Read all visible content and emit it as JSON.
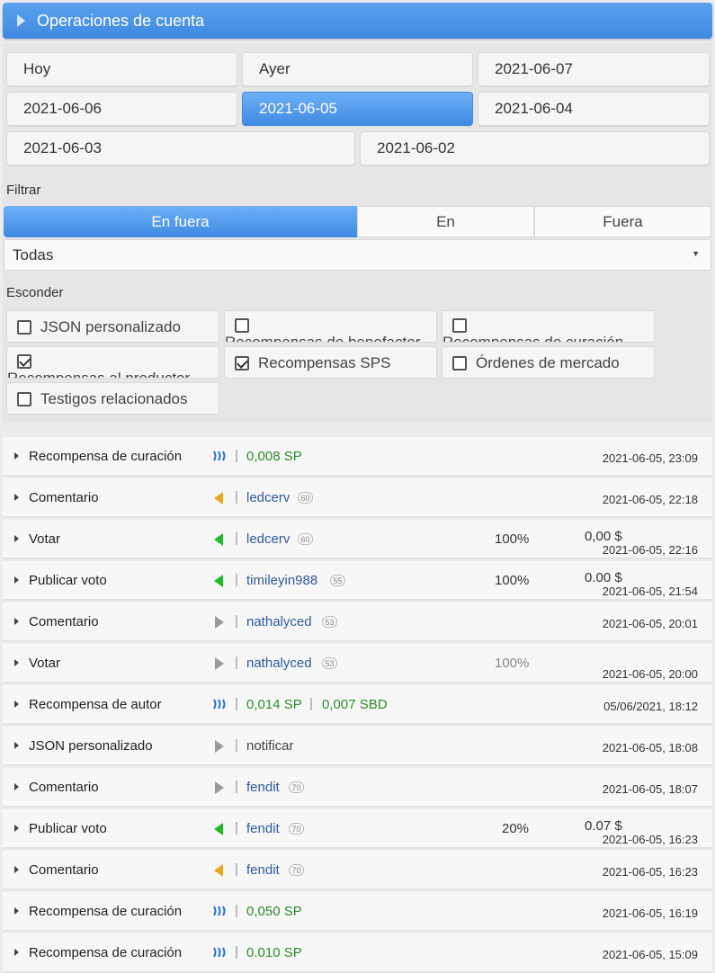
{
  "header": {
    "title": "Operaciones de cuenta"
  },
  "dates": [
    "Hoy",
    "Ayer",
    "2021-06-07",
    "2021-06-06",
    "2021-06-05",
    "2021-06-04",
    "2021-06-03",
    "2021-06-02"
  ],
  "filter": {
    "label": "Filtrar",
    "segments": [
      "En fuera",
      "En",
      "Fuera"
    ],
    "select_value": "Todas"
  },
  "hide": {
    "label": "Esconder",
    "options": [
      {
        "label": "JSON personalizado",
        "checked": false
      },
      {
        "label": "Recompensas de benefactor",
        "checked": false
      },
      {
        "label": "Recompensas de curación",
        "checked": false
      },
      {
        "label": "Recompensas al productor",
        "checked": true
      },
      {
        "label": "Recompensas SPS",
        "checked": true
      },
      {
        "label": "Órdenes de mercado",
        "checked": false
      },
      {
        "label": "Testigos relacionados",
        "checked": false
      }
    ]
  },
  "colors": {
    "accent": "#4a93e6",
    "green": "#2c8c2c",
    "link": "#2d5aa0",
    "orange": "#e8a81c",
    "green_icon": "#22bb22",
    "gray_icon": "#9a9a9a"
  },
  "operations": [
    {
      "type": "Recompensa de curación",
      "icon": "steem-icon",
      "amount": "0,008 SP",
      "date": "2021-06-05, 23:09"
    },
    {
      "type": "Comentario",
      "icon": "orange-left-triangle-icon",
      "user": "ledcerv",
      "rep": "60",
      "date": "2021-06-05, 22:18"
    },
    {
      "type": "Votar",
      "icon": "green-left-triangle-icon",
      "user": "ledcerv",
      "rep": "60",
      "percent": "100%",
      "value": "0,00 $",
      "date": "2021-06-05, 22:16"
    },
    {
      "type": "Publicar voto",
      "icon": "green-left-triangle-icon",
      "user": "timileyin988",
      "rep": "55",
      "percent": "100%",
      "value": "0.00 $",
      "date": "2021-06-05, 21:54"
    },
    {
      "type": "Comentario",
      "icon": "gray-right-triangle-icon",
      "user": "nathalyced",
      "rep": "53",
      "date": "2021-06-05, 20:01"
    },
    {
      "type": "Votar",
      "icon": "gray-right-triangle-icon",
      "user": "nathalyced",
      "rep": "53",
      "percent": "100%",
      "date": "2021-06-05, 20:00"
    },
    {
      "type": "Recompensa de autor",
      "icon": "steem-icon",
      "amount": "0,014 SP",
      "amount2": "0,007 SBD",
      "date": "05/06/2021, 18:12"
    },
    {
      "type": "JSON personalizado",
      "icon": "gray-right-triangle-icon",
      "text": "notificar",
      "date": "2021-06-05, 18:08"
    },
    {
      "type": "Comentario",
      "icon": "gray-right-triangle-icon",
      "user": "fendit",
      "rep": "70",
      "date": "2021-06-05, 18:07"
    },
    {
      "type": "Publicar voto",
      "icon": "green-left-triangle-icon",
      "user": "fendit",
      "rep": "70",
      "percent": "20%",
      "value": "0.07 $",
      "date": "2021-06-05, 16:23"
    },
    {
      "type": "Comentario",
      "icon": "orange-left-triangle-icon",
      "user": "fendit",
      "rep": "70",
      "date": "2021-06-05, 16:23"
    },
    {
      "type": "Recompensa de curación",
      "icon": "steem-icon",
      "amount": "0,050 SP",
      "date": "2021-06-05, 16:19"
    },
    {
      "type": "Recompensa de curación",
      "icon": "steem-icon",
      "amount": "0.010 SP",
      "date": "2021-06-05, 15:09"
    }
  ]
}
